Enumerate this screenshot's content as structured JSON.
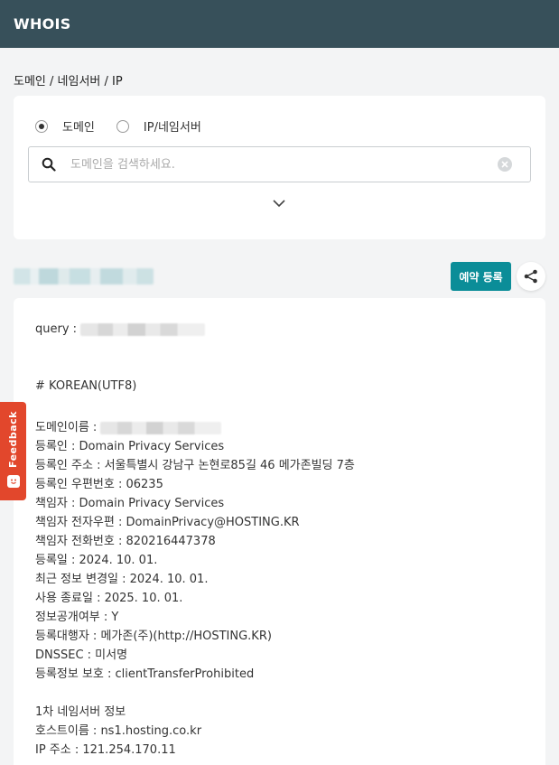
{
  "header": {
    "title": "WHOIS"
  },
  "breadcrumb": "도메인 / 네임서버 / IP",
  "search": {
    "options": [
      {
        "label": "도메인",
        "checked": true
      },
      {
        "label": "IP/네임서버",
        "checked": false
      }
    ],
    "placeholder": "도메인을 검색하세요.",
    "value": ""
  },
  "actions": {
    "reserve_label": "예약 등록"
  },
  "feedback": {
    "label": "Feedback"
  },
  "result": {
    "query_label": "query : ",
    "lines": {
      "korean": "# KOREAN(UTF8)",
      "domain_label": "도메인이름 : ",
      "registrant": "등록인 : Domain Privacy Services",
      "registrant_address": "등록인 주소 : 서울특별시 강남구 논현로85길 46 메가존빌딩 7층",
      "registrant_zip": "등록인 우편번호 : 06235",
      "admin": "책임자 : Domain Privacy Services",
      "admin_email": "책임자 전자우편 : DomainPrivacy@HOSTING.KR",
      "admin_phone": "책임자 전화번호 : 820216447378",
      "reg_date": "등록일 : 2024. 10. 01.",
      "updated": "최근 정보 변경일 : 2024. 10. 01.",
      "expires": "사용 종료일 : 2025. 10. 01.",
      "public": "정보공개여부 : Y",
      "registrar": "등록대행자 : 메가존(주)(http://HOSTING.KR)",
      "dnssec": "DNSSEC : 미서명",
      "protection": "등록정보 보호 : clientTransferProhibited",
      "ns_header": "1차 네임서버 정보",
      "host": "호스트이름 : ns1.hosting.co.kr",
      "ip": "IP 주소 : 121.254.170.11"
    }
  }
}
